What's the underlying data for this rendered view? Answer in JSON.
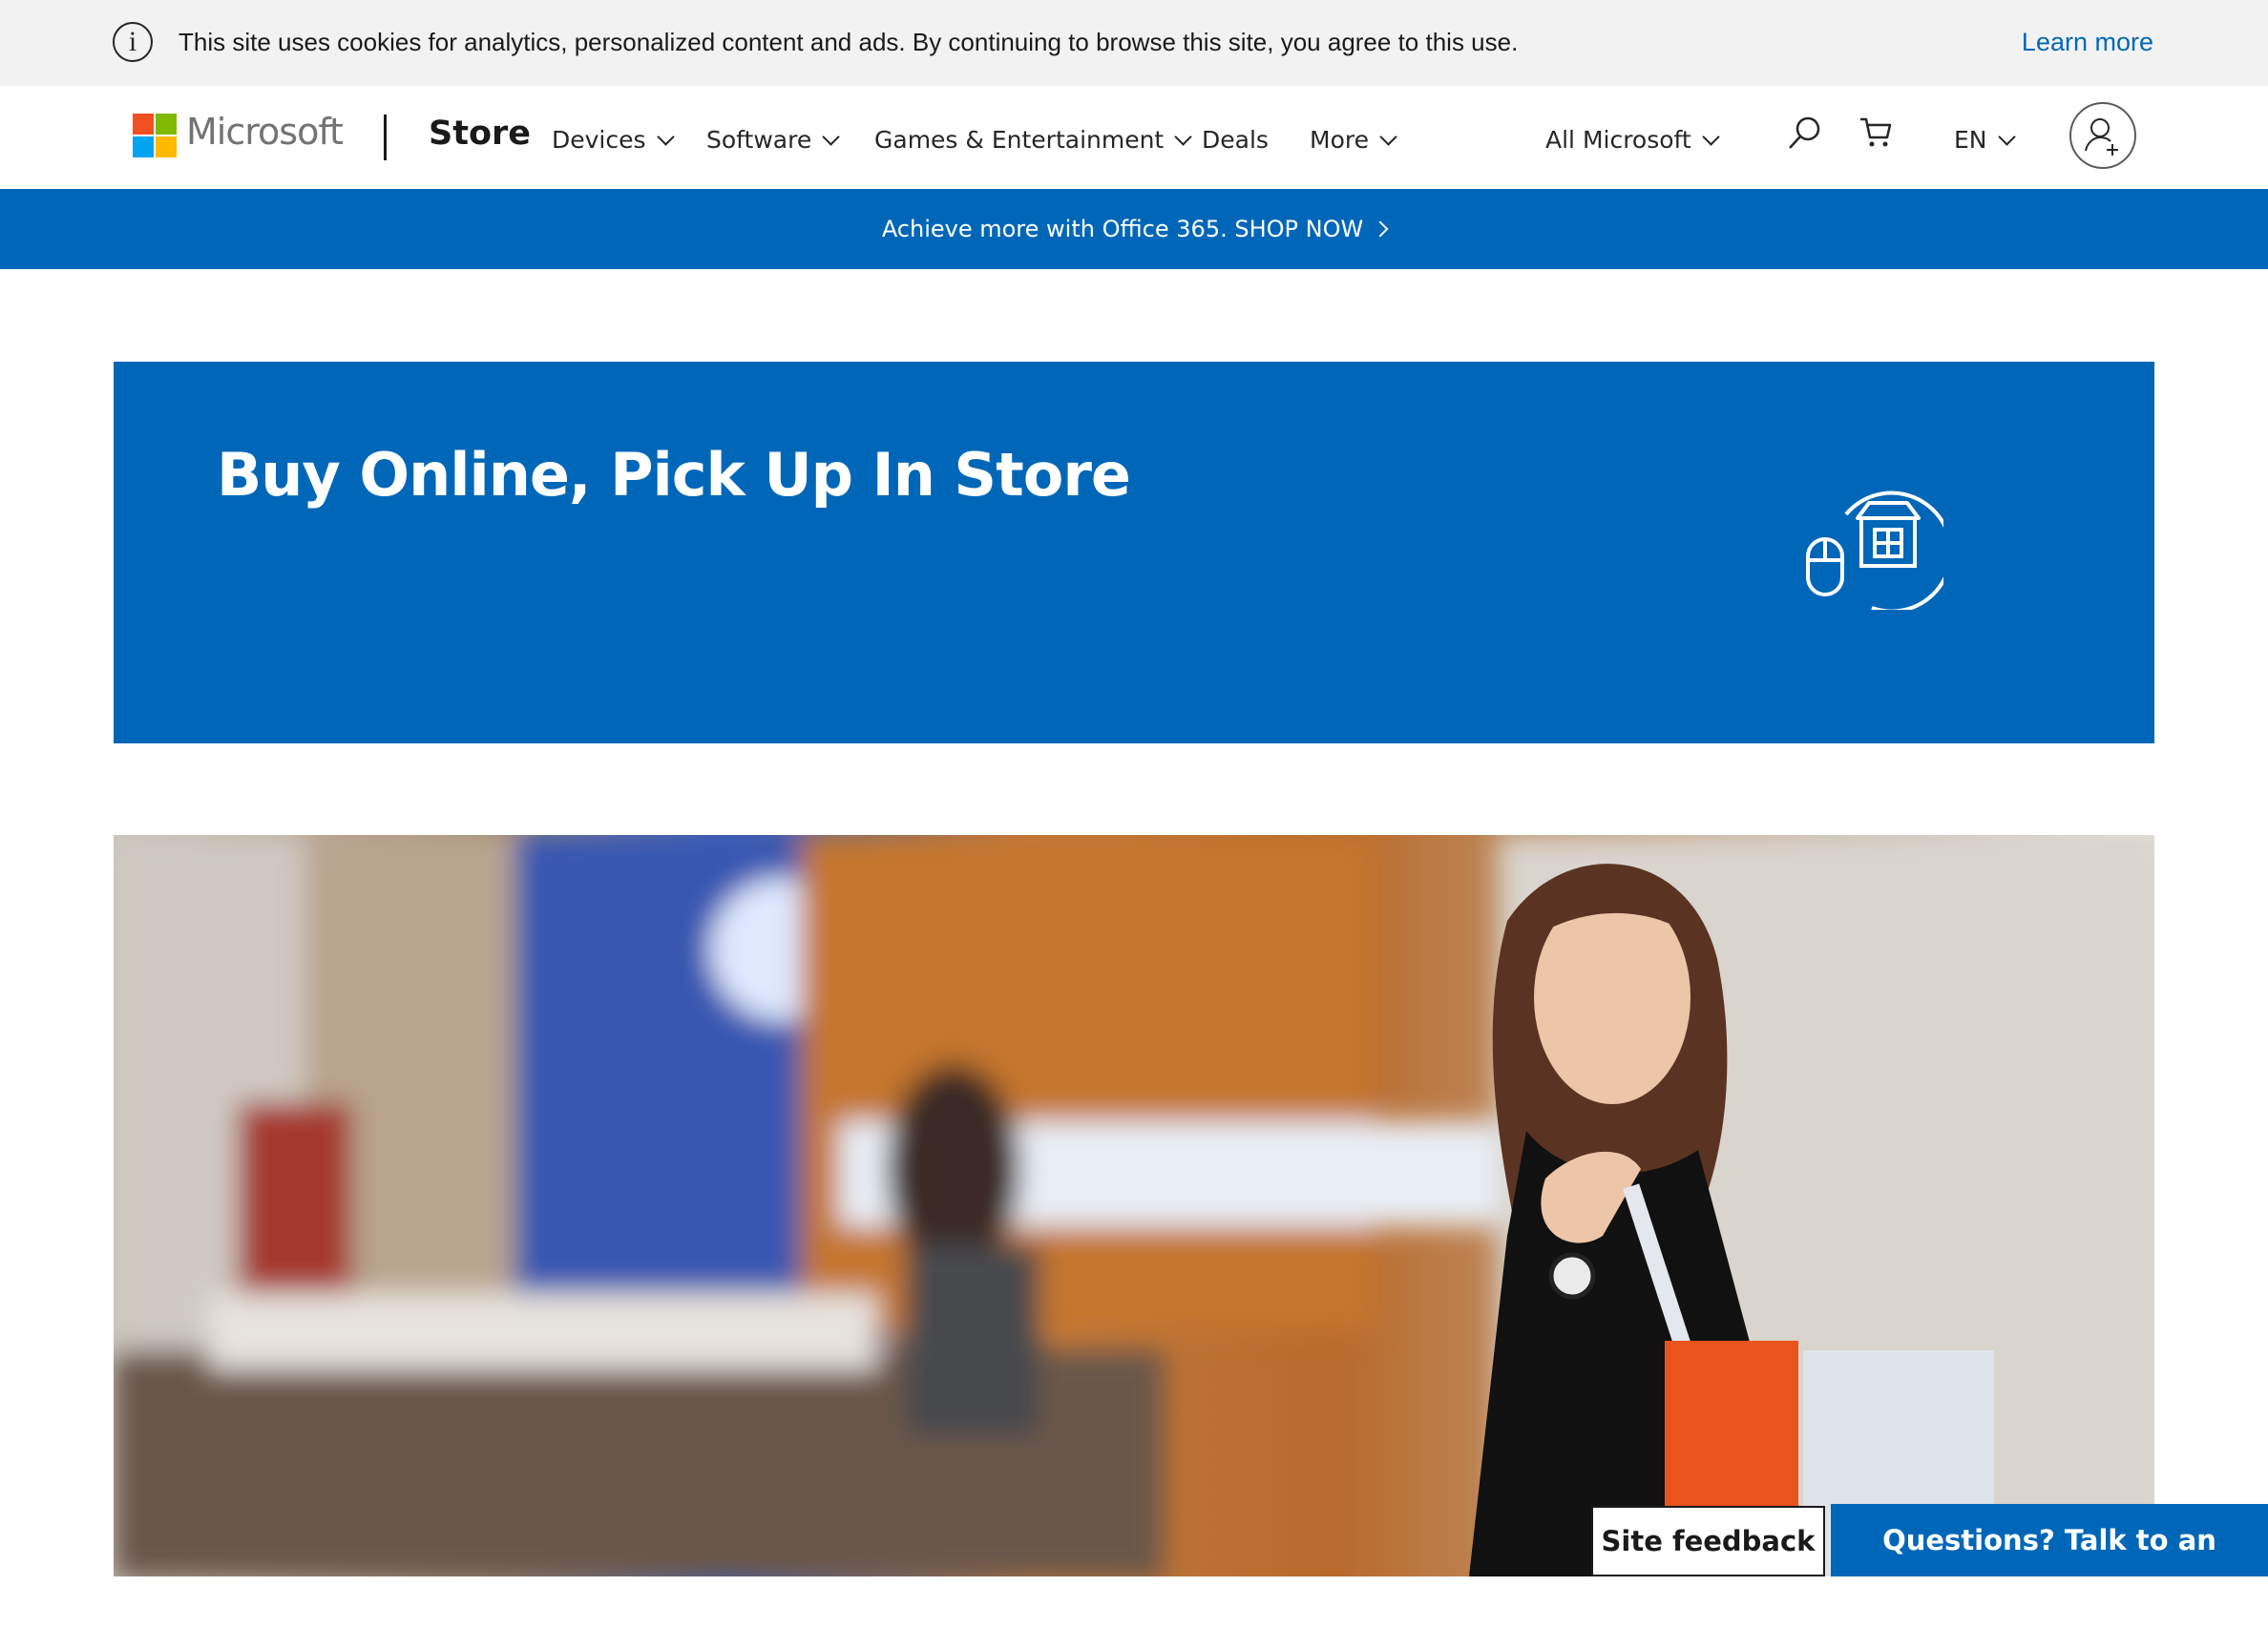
{
  "cookie_banner": {
    "message": "This site uses cookies for analytics, personalized content and ads. By continuing to browse this site, you agree to this use.",
    "learn_more": "Learn more",
    "icon": "info-icon"
  },
  "header": {
    "brand": "Microsoft",
    "store": "Store",
    "nav": [
      {
        "label": "Devices",
        "has_dropdown": true
      },
      {
        "label": "Software",
        "has_dropdown": true
      },
      {
        "label": "Games & Entertainment",
        "has_dropdown": true
      },
      {
        "label": "Deals",
        "has_dropdown": false
      },
      {
        "label": "More",
        "has_dropdown": true
      }
    ],
    "all_microsoft": "All Microsoft",
    "language": "EN",
    "icons": [
      "search-icon",
      "cart-icon",
      "sign-in-icon"
    ]
  },
  "promo": {
    "text": "Achieve more with Office 365. SHOP NOW"
  },
  "hero": {
    "title": "Buy Online, Pick Up In Store",
    "icon": "store-pickup-icon"
  },
  "floating": {
    "feedback": "Site feedback",
    "expert": "Questions? Talk to an expert"
  },
  "colors": {
    "accent_blue": "#0067b8",
    "cookie_bg": "#f2f2f2",
    "logo_red": "#f25022",
    "logo_green": "#7fba00",
    "logo_blue": "#00a4ef",
    "logo_yellow": "#ffb900"
  }
}
